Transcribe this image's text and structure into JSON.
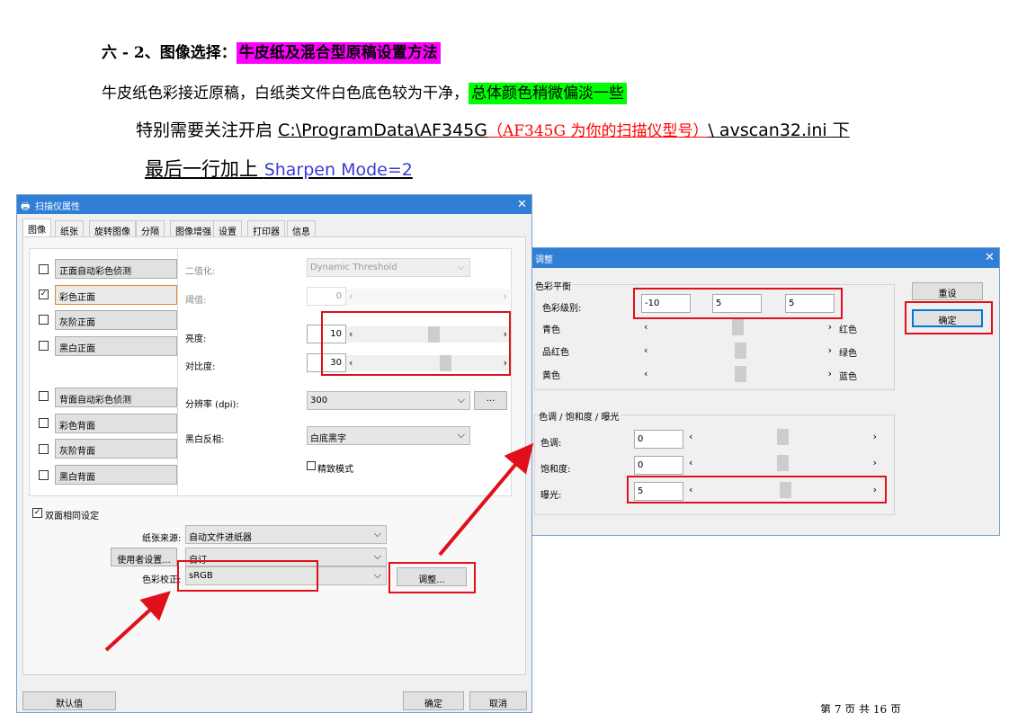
{
  "document": {
    "heading_prefix": "六 - 2、图像选择：",
    "heading_highlight": "牛皮纸及混合型原稿设置方法",
    "line2_text": "牛皮纸色彩接近原稿，白纸类文件白色底色较为干净，",
    "line2_highlight": "总体颜色稍微偏淡一些",
    "line3_prefix": "特别需要关注开启 ",
    "line3_path": "C:\\ProgramData\\AF345G",
    "line3_red": "（AF345G 为你的扫描仪型号）",
    "line3_suffix_path": "\\ avscan32.ini",
    "line3_suffix": "  下",
    "line4_prefix": "最后一行加上  ",
    "line4_setting": "Sharpen Mode=2",
    "footer": "第 7 页 共 16 页"
  },
  "colors": {
    "title_bar": "#2f7fd7",
    "highlight_magenta": "#ff00ff",
    "highlight_green": "#00ff00",
    "annotation_red": "#e0101a",
    "setting_blue": "#3b3bd8"
  },
  "dialog1": {
    "title": "扫描仪属性",
    "close": "✕",
    "tabs": [
      "图像",
      "纸张",
      "旋转图像",
      "分隔",
      "图像增强",
      "设置",
      "打印器",
      "信息"
    ],
    "image_options": [
      {
        "label": "正面自动彩色侦测",
        "checked": false
      },
      {
        "label": "彩色正面",
        "checked": true
      },
      {
        "label": "灰阶正面",
        "checked": false
      },
      {
        "label": "黑白正面",
        "checked": false
      },
      {
        "label": "背面自动彩色侦测",
        "checked": false
      },
      {
        "label": "彩色背面",
        "checked": false
      },
      {
        "label": "灰阶背面",
        "checked": false
      },
      {
        "label": "黑白背面",
        "checked": false
      }
    ],
    "binarize_label": "二值化:",
    "binarize_value": "Dynamic Threshold",
    "threshold_label": "阈值:",
    "threshold_value": "0",
    "brightness_label": "亮度:",
    "brightness_value": "10",
    "contrast_label": "对比度:",
    "contrast_value": "30",
    "resolution_label": "分辨率 (dpi):",
    "resolution_value": "300",
    "more_button": "...",
    "bw_invert_label": "黑白反相:",
    "bw_invert_value": "白底黑字",
    "fine_mode_label": "精致模式",
    "same_setting_label": "双面相同设定",
    "paper_source_label": "纸张来源:",
    "paper_source_value": "自动文件进纸器",
    "user_settings_button": "使用者设置...",
    "custom_value": "自订",
    "color_correction_label": "色彩校正:",
    "color_correction_value": "sRGB",
    "adjust_button": "调整...",
    "default_button": "默认值",
    "ok_button": "确定",
    "cancel_button": "取消",
    "icon_down": "⌵",
    "icon_left": "‹",
    "icon_right": "›",
    "brightness_level": 0.55,
    "contrast_level": 0.65
  },
  "dialog2": {
    "title": "调整",
    "close": "✕",
    "color_balance_group": "色彩平衡",
    "color_level_label": "色彩级别:",
    "color_levels": [
      "-10",
      "5",
      "5"
    ],
    "reset_button": "重设",
    "ok_button": "确定",
    "balance_rows": [
      {
        "left": "青色",
        "right": "红色",
        "level": 0.5
      },
      {
        "left": "品红色",
        "right": "绿色",
        "level": 0.52
      },
      {
        "left": "黄色",
        "right": "蓝色",
        "level": 0.52
      }
    ],
    "hue_group": "色调 / 饱和度 / 曝光",
    "hue_label": "色调:",
    "hue_value": "0",
    "saturation_label": "饱和度:",
    "saturation_value": "0",
    "exposure_label": "曝光:",
    "exposure_value": "5",
    "hue_level": 0.5,
    "saturation_level": 0.5,
    "exposure_level": 0.52
  }
}
